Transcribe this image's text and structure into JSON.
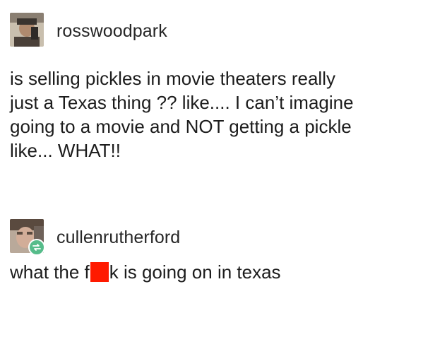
{
  "posts": [
    {
      "username": "rosswoodpark",
      "avatar_icon": "user-avatar-icon",
      "lines": [
        "is selling pickles in movie theaters really",
        "just a Texas thing ?? like.... I can’t imagine",
        "going to a movie and NOT getting a pickle",
        "like... WHAT!!"
      ]
    },
    {
      "username": "cullenrutherford",
      "avatar_icon": "user-avatar-icon",
      "badge_icon": "reblog-icon",
      "badge_color": "#56bc8a",
      "text_before_censor": "what the f",
      "text_after_censor": "k is going on in texas",
      "censor_color": "#ff1a00"
    }
  ]
}
